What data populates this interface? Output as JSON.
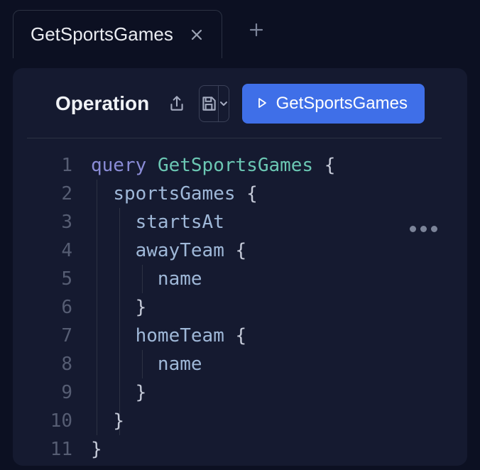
{
  "tabs": {
    "active": {
      "label": "GetSportsGames"
    }
  },
  "panel": {
    "title": "Operation",
    "runLabel": "GetSportsGames"
  },
  "code": {
    "lineNumbers": [
      "1",
      "2",
      "3",
      "4",
      "5",
      "6",
      "7",
      "8",
      "9",
      "10",
      "11"
    ],
    "tokens": {
      "queryKeyword": "query",
      "operationName": "GetSportsGames",
      "sportsGames": "sportsGames",
      "startsAt": "startsAt",
      "awayTeam": "awayTeam",
      "homeTeam": "homeTeam",
      "name": "name",
      "openBrace": "{",
      "closeBrace": "}"
    }
  }
}
